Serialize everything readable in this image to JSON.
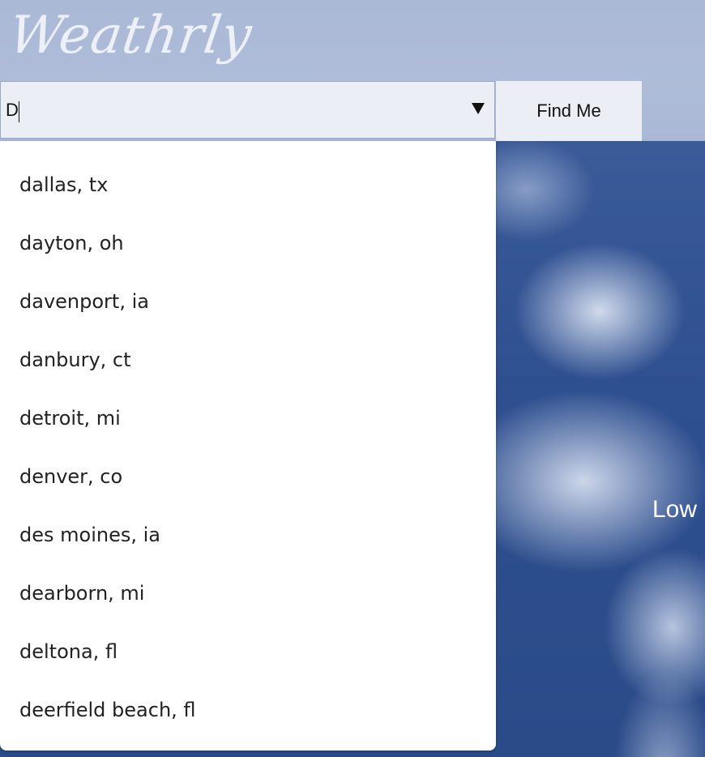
{
  "app": {
    "logo_text": "Weathrly"
  },
  "search": {
    "value": "D",
    "find_me_label": "Find Me"
  },
  "suggestions": [
    "dallas, tx",
    "dayton, oh",
    "davenport, ia",
    "danbury, ct",
    "detroit, mi",
    "denver, co",
    "des moines, ia",
    "dearborn, mi",
    "deltona, fl",
    "deerfield beach, fl"
  ],
  "background": {
    "partial_label": "Low"
  },
  "colors": {
    "header_band": "#aebcd8",
    "input_bg": "#eceef5",
    "sky": "#2f5090",
    "dropdown_bg": "#ffffff"
  },
  "icons": {
    "dropdown": "triangle-down-icon"
  }
}
